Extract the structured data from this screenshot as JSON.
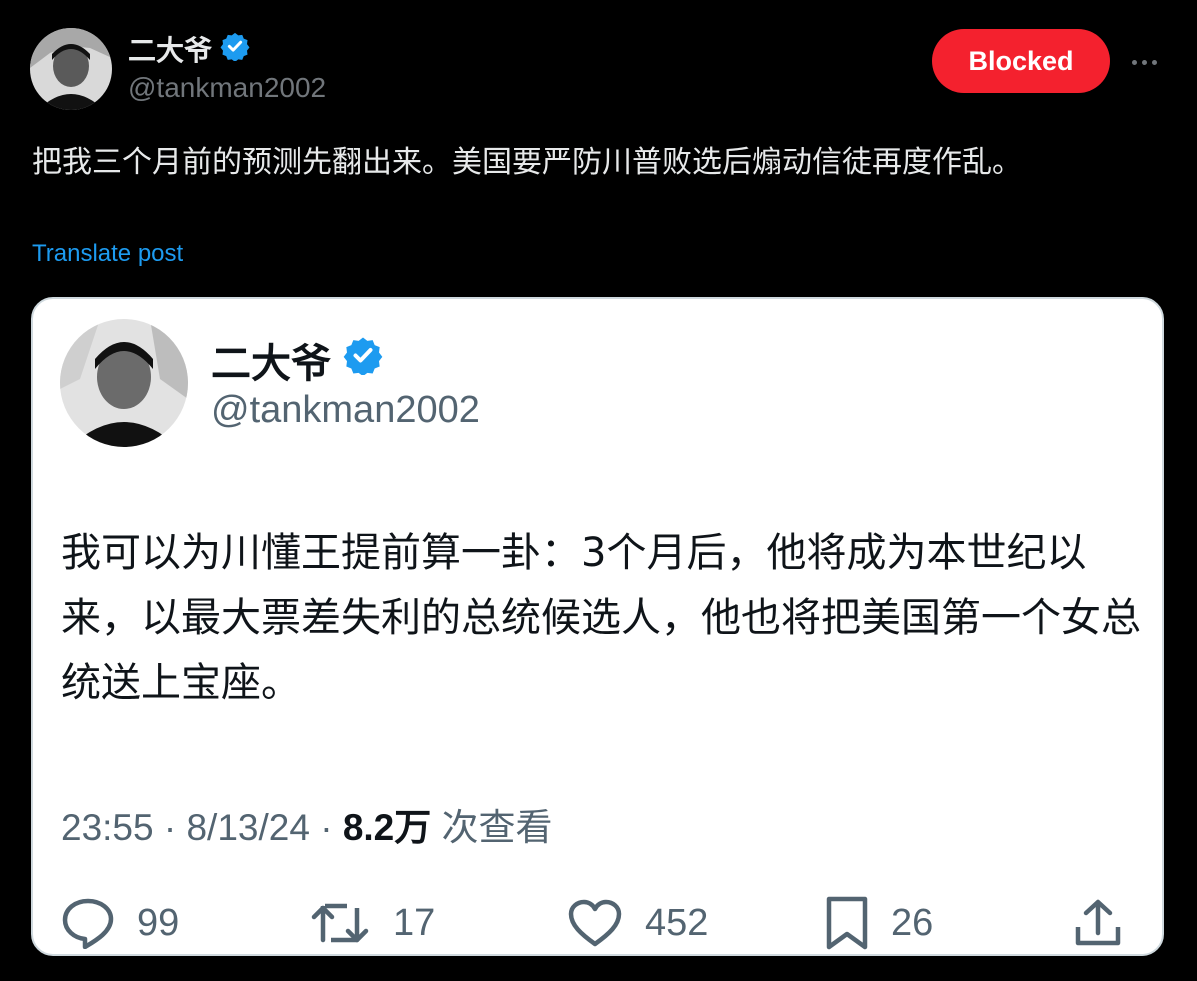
{
  "post": {
    "author": {
      "name": "二大爷",
      "handle": "@tankman2002",
      "verified_icon": "verified-badge-icon"
    },
    "blocked_label": "Blocked",
    "more_icon": "more-dots-icon",
    "text": "把我三个月前的预测先翻出来。美国要严防川普败选后煽动信徒再度作乱。",
    "translate_label": "Translate post"
  },
  "quoted_screenshot": {
    "author": {
      "name": "二大爷",
      "handle": "@tankman2002"
    },
    "text": "我可以为川懂王提前算一卦：3个月后，他将成为本世纪以来，以最大票差失利的总统候选人，他也将把美国第一个女总统送上宝座。",
    "time": "23:55",
    "date": "8/13/24",
    "views_count": "8.2万",
    "views_label": "次查看",
    "separator": "·",
    "actions": {
      "replies": "99",
      "reposts": "17",
      "likes": "452",
      "bookmarks": "26"
    }
  },
  "colors": {
    "background": "#000000",
    "blocked_button": "#f4212e",
    "link": "#1d9bf0",
    "verified": "#1d9bf0",
    "card_background": "#ffffff"
  }
}
